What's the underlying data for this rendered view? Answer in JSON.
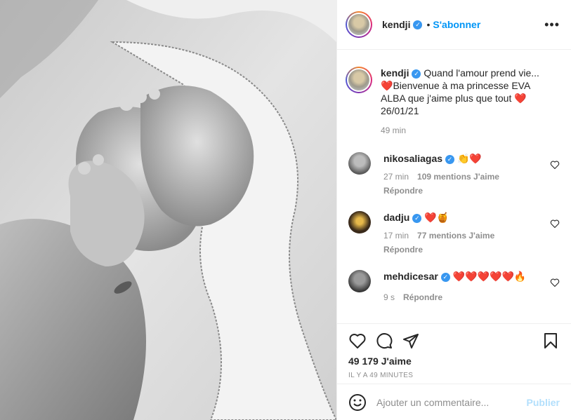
{
  "post": {
    "image_alt": "baby feet held by a hand, black and white photo"
  },
  "header": {
    "username": "kendji",
    "dot": "•",
    "follow_label": "S'abonner",
    "more_label": "•••"
  },
  "caption": {
    "username": "kendji",
    "line1": "Quand l'amour prend vie...",
    "line2": "Bienvenue à ma princesse EVA ALBA que j'aime plus que tout",
    "line3": "26/01/21",
    "time": "49 min"
  },
  "comments": [
    {
      "username": "nikosaliagas",
      "text": "👏❤️",
      "time": "27 min",
      "likes": "109 mentions J'aime",
      "reply": "Répondre"
    },
    {
      "username": "dadju",
      "text": "❤️🍯",
      "time": "17 min",
      "likes": "77 mentions J'aime",
      "reply": "Répondre"
    },
    {
      "username": "mehdicesar",
      "text": "❤️❤️❤️❤️❤️🔥",
      "time": "9 s",
      "reply": "Répondre"
    }
  ],
  "actions": {
    "likes": "49 179 J'aime",
    "timestamp": "IL Y A 49 MINUTES"
  },
  "composer": {
    "placeholder": "Ajouter un commentaire...",
    "publish_label": "Publier"
  },
  "colors": {
    "accent": "#0095f6",
    "heart": "#e8112d",
    "muted": "#8e8e8e"
  }
}
